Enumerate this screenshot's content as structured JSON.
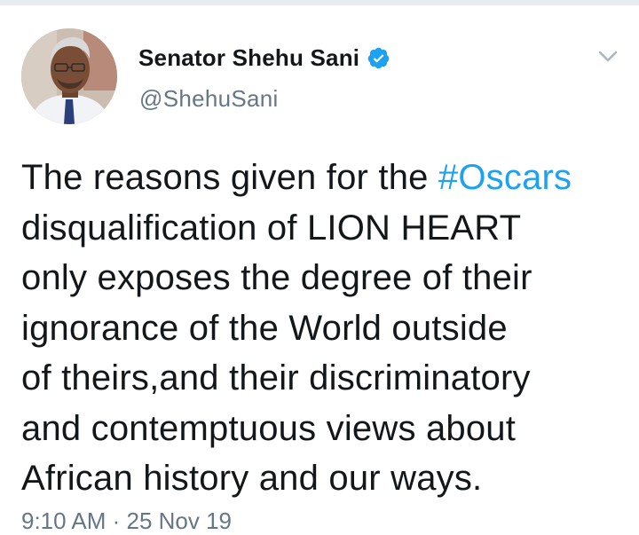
{
  "tweet": {
    "display_name": "Senator Shehu Sani",
    "handle": "@ShehuSani",
    "verified": true,
    "text_lines": [
      {
        "pre": "The reasons given for the ",
        "hashtag": "#Oscars"
      },
      {
        "pre": "disqualification of LION HEART"
      },
      {
        "pre": "only exposes the degree of their"
      },
      {
        "pre": "ignorance of the World outside"
      },
      {
        "pre": "of theirs,and their discriminatory"
      },
      {
        "pre": "and contemptuous views about"
      },
      {
        "pre": "African history and our ways."
      }
    ],
    "timestamp": "9:10 AM · 25 Nov 19"
  },
  "icons": {
    "verified": "verified-badge-icon",
    "menu": "chevron-down-icon"
  },
  "colors": {
    "name": "#14171a",
    "secondary": "#657786",
    "hashtag": "#1da1f2",
    "verified": "#1da1f2"
  }
}
